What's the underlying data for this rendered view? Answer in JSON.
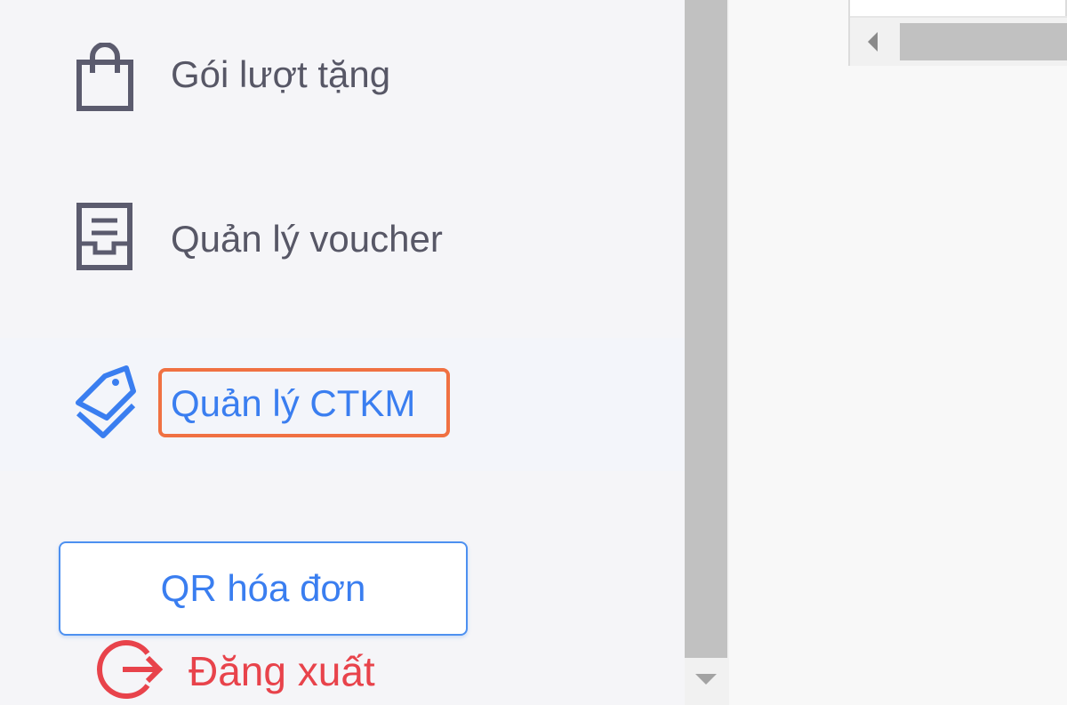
{
  "sidebar": {
    "items": [
      {
        "label": "Gói lượt tặng",
        "icon": "shopping-bag-icon"
      },
      {
        "label": "Quản lý voucher",
        "icon": "voucher-tray-icon"
      },
      {
        "label": "Quản lý CTKM",
        "icon": "tags-icon",
        "active": true
      }
    ],
    "qr_button_label": "QR hóa đơn",
    "logout_label": "Đăng xuất"
  },
  "colors": {
    "accent": "#3a7ef0",
    "text": "#575766",
    "danger": "#e8434b",
    "highlight": "#f07142"
  }
}
